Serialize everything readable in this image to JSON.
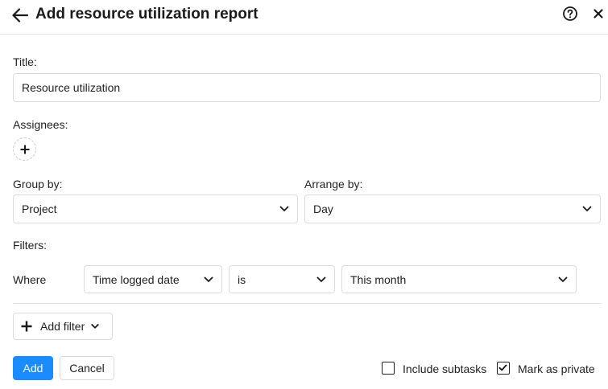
{
  "header": {
    "title": "Add resource utilization report"
  },
  "form": {
    "title_label": "Title:",
    "title_value": "Resource utilization",
    "assignees_label": "Assignees:",
    "group_by_label": "Group by:",
    "group_by_value": "Project",
    "arrange_by_label": "Arrange by:",
    "arrange_by_value": "Day",
    "filters_label": "Filters:",
    "filter": {
      "where_label": "Where",
      "field": "Time logged date",
      "operator": "is",
      "value": "This month"
    },
    "add_filter_label": "Add filter"
  },
  "footer": {
    "add_label": "Add",
    "cancel_label": "Cancel",
    "include_subtasks_label": "Include subtasks",
    "include_subtasks_checked": false,
    "mark_private_label": "Mark as private",
    "mark_private_checked": true
  },
  "colors": {
    "primary": "#1a8cff",
    "border": "#dcdcdc",
    "text": "#1f1f1f"
  },
  "icons": [
    "arrow-left-icon",
    "help-circle-icon",
    "close-icon",
    "plus-icon",
    "chevron-down-icon",
    "check-icon"
  ]
}
